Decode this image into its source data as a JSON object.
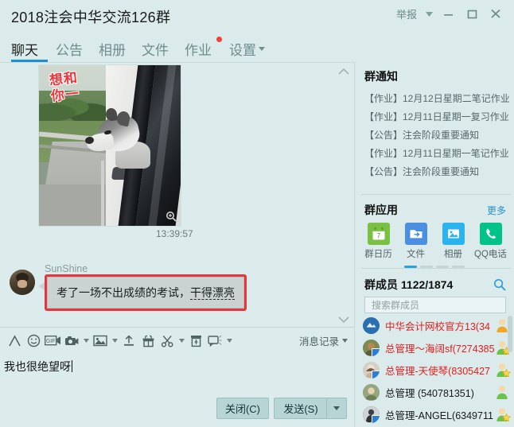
{
  "titlebar": {
    "title": "2018注会中华交流126群",
    "report_label": "举报",
    "minimize_icon": "minimize-icon",
    "maximize_icon": "maximize-icon",
    "close_icon": "close-icon"
  },
  "tabs": [
    {
      "label": "聊天",
      "active": true,
      "dot": false,
      "caret": false
    },
    {
      "label": "公告",
      "active": false,
      "dot": false,
      "caret": false
    },
    {
      "label": "相册",
      "active": false,
      "dot": false,
      "caret": false
    },
    {
      "label": "文件",
      "active": false,
      "dot": false,
      "caret": false
    },
    {
      "label": "作业",
      "active": false,
      "dot": true,
      "caret": false
    },
    {
      "label": "设置",
      "active": false,
      "dot": false,
      "caret": true
    }
  ],
  "chat": {
    "image_message": {
      "sticker_text": "想和你一",
      "alt": "husky dog looking out of car window",
      "timestamp": "13:39:57"
    },
    "text_message": {
      "sender": "SunShine",
      "text_plain": "考了一场不出成绩的考试，干得漂亮",
      "text_head": "考了一场不出成绩的考试，",
      "text_underlined": "干得漂亮",
      "highlight_color": "#e8343c"
    }
  },
  "toolbar": {
    "items": [
      {
        "name": "font-icon",
        "caret": false
      },
      {
        "name": "emoji-icon",
        "caret": false
      },
      {
        "name": "gif-icon",
        "caret": false
      },
      {
        "name": "screenshot-icon",
        "caret": true
      },
      {
        "name": "image-icon",
        "caret": true
      },
      {
        "name": "upload-icon",
        "caret": false
      },
      {
        "name": "gift-icon",
        "caret": false
      },
      {
        "name": "scissors-icon",
        "caret": true
      },
      {
        "name": "card-icon",
        "caret": false
      },
      {
        "name": "shake-icon",
        "caret": true
      }
    ],
    "message_log_label": "消息记录"
  },
  "input": {
    "value": "我也很绝望呀",
    "placeholder": ""
  },
  "bottom": {
    "close_label": "关闭(C)",
    "close_key": "C",
    "send_label": "发送(S)",
    "send_key": "S",
    "send_caret": "chevron-down-icon"
  },
  "right_panel": {
    "notice": {
      "title": "群通知",
      "items": [
        "【作业】12月12日星期二笔记作业",
        "【作业】12月11日星期一复习作业",
        "【公告】注会阶段重要通知",
        "【作业】12月11日星期一笔记作业",
        "【公告】注会阶段重要通知"
      ]
    },
    "apps": {
      "title": "群应用",
      "more_label": "更多",
      "items": [
        {
          "label": "群日历",
          "icon": "calendar-icon",
          "color": "#7ac143",
          "day": "7"
        },
        {
          "label": "文件",
          "icon": "folder-icon",
          "color": "#4a8fe0"
        },
        {
          "label": "相册",
          "icon": "photo-icon",
          "color": "#2bb3f0"
        },
        {
          "label": "QQ电话",
          "icon": "phone-icon",
          "color": "#00c389"
        }
      ],
      "page_dots": 4,
      "active_dot": 0
    },
    "members": {
      "title": "群成员",
      "count": "1122/1874",
      "search_icon": "search-icon",
      "search_placeholder": "搜索群成员",
      "search_value": "",
      "list": [
        {
          "name": "中华会计网校官方13(34",
          "color": "red",
          "role": "owner",
          "star": false,
          "avatar": "#2a6fb0",
          "badge": false
        },
        {
          "name": "总管理～海阔sf(7274385",
          "color": "red",
          "role": "admin",
          "star": true,
          "avatar": "#6d7a4a",
          "badge": true
        },
        {
          "name": "总管理-天使琴(8305427",
          "color": "red",
          "role": "admin",
          "star": true,
          "avatar": "#b8b0a4",
          "badge": true
        },
        {
          "name": "总管理 (540781351)",
          "color": "black",
          "role": "member",
          "star": false,
          "avatar": "#8a9a78",
          "badge": false
        },
        {
          "name": "总管理-ANGEL(6349711",
          "color": "black",
          "role": "admin",
          "star": true,
          "avatar": "#5d5f63",
          "badge": true
        }
      ]
    }
  },
  "colors": {
    "window_bg": "#dbeaea",
    "chat_bg": "#dceced",
    "accent_blue": "#1b8fd4",
    "badge_red": "#f3402f",
    "link_blue": "#2a8fd0"
  }
}
